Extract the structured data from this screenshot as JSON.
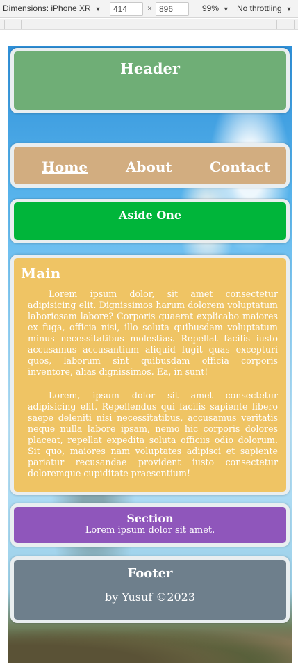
{
  "devtools": {
    "dimensions_label": "Dimensions: iPhone XR",
    "width_value": "414",
    "height_value": "896",
    "zoom": "99%",
    "throttling": "No throttling"
  },
  "page": {
    "header": {
      "title": "Header"
    },
    "nav": {
      "items": [
        "Home",
        "About",
        "Contact"
      ]
    },
    "aside": {
      "title": "Aside One"
    },
    "main": {
      "title": "Main",
      "paragraphs": [
        "Lorem ipsum dolor, sit amet consectetur adipisicing elit. Dignissimos harum dolorem voluptatum laboriosam labore? Corporis quaerat explicabo maiores ex fuga, officia nisi, illo soluta quibusdam voluptatum minus necessitatibus molestias. Repellat facilis iusto accusamus accusantium aliquid fugit quas excepturi quos, laborum sint quibusdam officia corporis inventore, alias dignissimos. Ea, in sunt!",
        "Lorem, ipsum dolor sit amet consectetur adipisicing elit. Repellendus qui facilis sapiente libero saepe deleniti nisi necessitatibus, accusamus veritatis neque nulla labore ipsam, nemo hic corporis dolores placeat, repellat expedita soluta officiis odio dolorum. Sit quo, maiores nam voluptates adipisci et sapiente pariatur recusandae provident iusto consectetur doloremque cupiditate praesentium!"
      ]
    },
    "section": {
      "title": "Section",
      "text": "Lorem ipsum dolor sit amet."
    },
    "footer": {
      "title": "Footer",
      "credit": "by Yusuf ©2023"
    }
  },
  "colors": {
    "header": "#6fae76",
    "nav": "#d2ad80",
    "aside": "#00b53a",
    "main": "#efc464",
    "section": "#8f56bb",
    "footer": "#6e7f8c"
  }
}
